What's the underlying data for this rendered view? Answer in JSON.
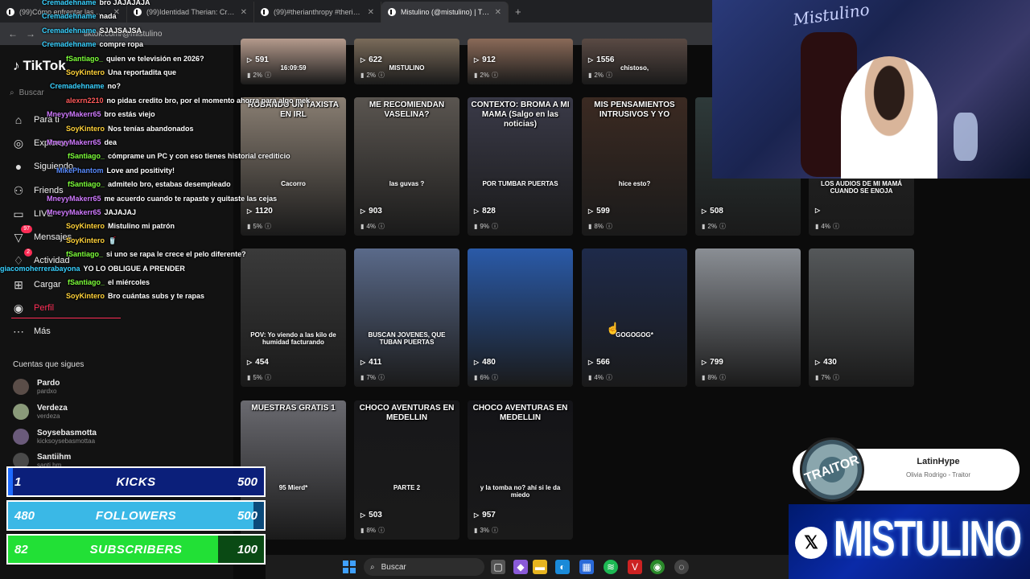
{
  "browser": {
    "tabs": [
      {
        "title": "(99)Cómo enfrentar las modas",
        "active": false
      },
      {
        "title": "(99)Identidad Therian: Creerse",
        "active": false
      },
      {
        "title": "(99)#therianthropy #therian | T",
        "active": false
      },
      {
        "title": "Mistulino (@mistulino) | TikTok",
        "active": true
      }
    ],
    "new_tab_icon": "plus-icon",
    "url": "tiktok.com/@mistulino"
  },
  "sidebar": {
    "logo": "TikTok",
    "search_placeholder": "Buscar",
    "nav": [
      {
        "label": "Para ti",
        "icon": "home-icon"
      },
      {
        "label": "Explorar",
        "icon": "compass-icon"
      },
      {
        "label": "Siguiendo",
        "icon": "following-icon"
      },
      {
        "label": "Friends",
        "icon": "friends-icon"
      },
      {
        "label": "LIVE",
        "icon": "live-icon"
      },
      {
        "label": "Mensajes",
        "icon": "inbox-icon",
        "badge": "97"
      },
      {
        "label": "Actividad",
        "icon": "activity-icon",
        "badge": "2"
      },
      {
        "label": "Cargar",
        "icon": "upload-icon"
      },
      {
        "label": "Perfil",
        "icon": "profile-icon",
        "active": true
      },
      {
        "label": "Más",
        "icon": "more-icon"
      }
    ],
    "follows_title": "Cuentas que sigues",
    "follows": [
      {
        "name": "Pardo",
        "handle": "pardxo"
      },
      {
        "name": "Verdeza",
        "handle": "verdeza"
      },
      {
        "name": "Soysebasmotta",
        "handle": "kicksoysebasmottaa"
      },
      {
        "name": "Santiihm",
        "handle": "santi.hm"
      }
    ]
  },
  "chat": [
    {
      "user": "Cremadehname",
      "text": "bro JAJAJAJA",
      "color": "#39d1ff"
    },
    {
      "user": "Cremadehname",
      "text": "nada",
      "color": "#39d1ff"
    },
    {
      "user": "Cremadehname",
      "text": "SJAJSAJSA",
      "color": "#39d1ff"
    },
    {
      "user": "Cremadehname",
      "text": "compre ropa",
      "color": "#39d1ff"
    },
    {
      "user": "fSantiago_",
      "text": "quien ve televisión en 2026?",
      "color": "#7dff3a"
    },
    {
      "user": "SoyKintero",
      "text": "Una reportadita que",
      "color": "#ffd23a"
    },
    {
      "user": "Cremadehname",
      "text": "no?",
      "color": "#39d1ff"
    },
    {
      "user": "alexrn2210",
      "text": "no pidas credito bro, por el momento ahorra para algo mek",
      "color": "#ff5a5a"
    },
    {
      "user": "MneyyMakerr65",
      "text": "bro estás viejo",
      "color": "#d07aff"
    },
    {
      "user": "SoyKintero",
      "text": "Nos tenías abandonados",
      "color": "#ffd23a"
    },
    {
      "user": "MneyyMakerr65",
      "text": "dea",
      "color": "#d07aff"
    },
    {
      "user": "fSantiago_",
      "text": "cómprame un PC y con eso tienes historial crediticio",
      "color": "#7dff3a"
    },
    {
      "user": "MikePhantom",
      "text": "Love and positivity!",
      "color": "#5a8cff"
    },
    {
      "user": "fSantiago_",
      "text": "admitelo bro, estabas desempleado",
      "color": "#7dff3a"
    },
    {
      "user": "MneyyMakerr65",
      "text": "me acuerdo cuando te rapaste y quitaste las cejas",
      "color": "#d07aff"
    },
    {
      "user": "MneyyMakerr65",
      "text": "JAJAJAJ",
      "color": "#d07aff"
    },
    {
      "user": "SoyKintero",
      "text": "Mistulino mi patrón",
      "color": "#ffd23a"
    },
    {
      "user": "SoyKintero",
      "text": "🥤",
      "color": "#ffd23a"
    },
    {
      "user": "fSantiago_",
      "text": "si uno se rapa le crece el pelo diferente?",
      "color": "#7dff3a"
    },
    {
      "user": "giacomoherrerabayona",
      "text": "YO LO OBLIGUE A PRENDER",
      "color": "#39d1ff"
    },
    {
      "user": "fSantiago_",
      "text": "el miércoles",
      "color": "#7dff3a"
    },
    {
      "user": "SoyKintero",
      "text": "Bro cuántas subs y te rapas",
      "color": "#ffd23a"
    }
  ],
  "videos": [
    {
      "views": "591",
      "pct": "2%",
      "caption": "",
      "overlay": "16:09:59",
      "bg": "#b49a8c"
    },
    {
      "views": "622",
      "pct": "2%",
      "caption": "",
      "overlay": "MISTULINO",
      "bg": "#7a6b5a"
    },
    {
      "views": "912",
      "pct": "2%",
      "caption": "",
      "overlay": "",
      "bg": "#8a6a58"
    },
    {
      "views": "1556",
      "pct": "2%",
      "caption": "",
      "overlay": "chistoso,",
      "bg": "#5a4a44"
    },
    {
      "views": "1120",
      "pct": "5%",
      "caption": "ROBANDO UN TAXISTA EN IRL",
      "overlay": "Cacorro",
      "bg": "#8a7f73"
    },
    {
      "views": "903",
      "pct": "4%",
      "caption": "ME RECOMIENDAN VASELINA?",
      "overlay": "las guvas ?",
      "bg": "#5a5550"
    },
    {
      "views": "828",
      "pct": "9%",
      "caption": "CONTEXTO: BROMA A MI MAMA (Salgo en las noticias)",
      "overlay": "POR TUMBAR PUERTAS",
      "bg": "#3a3a48"
    },
    {
      "views": "599",
      "pct": "8%",
      "caption": "MIS PENSAMIENTOS INTRUSIVOS Y YO",
      "overlay": "hice esto?",
      "bg": "#3b2a22"
    },
    {
      "views": "508",
      "pct": "2%",
      "caption": "",
      "overlay": "",
      "bg": "#2e3a3a"
    },
    {
      "views": "",
      "pct": "4%",
      "caption": "",
      "overlay": "LOS AUDIOS DE MI MAMÁ CUANDO SE ENOJA",
      "bg": "#262626"
    },
    {
      "views": "454",
      "pct": "5%",
      "caption": "",
      "overlay": "POV: Yo viendo a las kilo de humidad facturando",
      "bg": "#3a3a3a"
    },
    {
      "views": "411",
      "pct": "7%",
      "caption": "",
      "overlay": "BUSCAN JOVENES, QUE TUBAN PUERTAS",
      "bg": "#5a6a8a"
    },
    {
      "views": "480",
      "pct": "6%",
      "caption": "",
      "overlay": "",
      "bg": "#2a5aa8"
    },
    {
      "views": "566",
      "pct": "4%",
      "caption": "",
      "overlay": "GOGOGOG*",
      "bg": "#1e2a4a"
    },
    {
      "views": "799",
      "pct": "8%",
      "caption": "",
      "overlay": "",
      "bg": "#8a8e94"
    },
    {
      "views": "430",
      "pct": "7%",
      "caption": "",
      "overlay": "",
      "bg": "#55585a"
    },
    {
      "views": "",
      "pct": "",
      "caption": "MUESTRAS GRATIS 1",
      "overlay": "95 Mierd*",
      "bg": "#6a6a70"
    },
    {
      "views": "503",
      "pct": "8%",
      "caption": "CHOCO AVENTURAS EN MEDELLIN",
      "overlay": "PARTE 2",
      "bg": "#18181a"
    },
    {
      "views": "957",
      "pct": "3%",
      "caption": "CHOCO AVENTURAS EN MEDELLIN",
      "overlay": "y la tomba no? ahí si le da miedo",
      "bg": "#141418"
    }
  ],
  "music": {
    "title": "LatinHype",
    "subtitle": "Olivia Rodrigo - Traitor",
    "disc_text": "TRAITOR"
  },
  "banner": {
    "name": "MISTULINO",
    "icon": "x-logo-icon"
  },
  "cam": {
    "signature": "Mistulino"
  },
  "stats": [
    {
      "left": "1",
      "label": "KICKS",
      "right": "500",
      "progress": 0.002,
      "color": "#1e6bff",
      "bg": "#0b1f7a"
    },
    {
      "left": "480",
      "label": "FOLLOWERS",
      "right": "500",
      "progress": 0.96,
      "color": "#3ab8e6",
      "bg": "#0b4a7a"
    },
    {
      "left": "82",
      "label": "SUBSCRIBERS",
      "right": "100",
      "progress": 0.82,
      "color": "#22e036",
      "bg": "#0a4a14"
    }
  ],
  "taskbar": {
    "search_placeholder": "Buscar"
  }
}
